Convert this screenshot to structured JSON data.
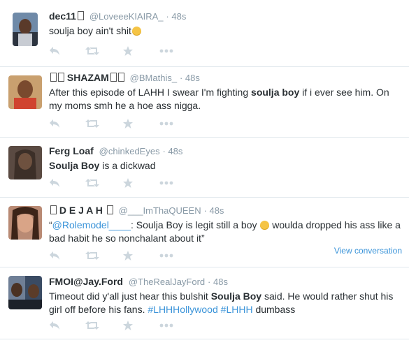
{
  "tweets": [
    {
      "fullname": "dec11",
      "fullname_suffix_box": true,
      "username": "@LoveeeKIAIRA_",
      "time": "48s",
      "text_parts": [
        {
          "t": "soulja boy ain't shit",
          "style": "plain"
        }
      ],
      "emoji_end": "sad-face-emoji"
    },
    {
      "fullname_prefix_boxes": 2,
      "fullname": "SHAZAM",
      "fullname_suffix_boxes": 2,
      "username": "@BMathis_",
      "time": "48s",
      "text_parts": [
        {
          "t": "After this episode of LAHH I swear I'm fighting ",
          "style": "plain"
        },
        {
          "t": "soulja boy",
          "style": "bold"
        },
        {
          "t": " if i ever see him. On my moms smh he a hoe ass nigga.",
          "style": "plain"
        }
      ]
    },
    {
      "fullname": "Ferg Loaf",
      "username": "@chinkedEyes",
      "time": "48s",
      "text_parts": [
        {
          "t": "Soulja Boy",
          "style": "bold"
        },
        {
          "t": " is a dickwad",
          "style": "plain"
        }
      ]
    },
    {
      "fullname_prefix_boxes": 1,
      "fullname": "D E J A H",
      "fullname_suffix_boxes": 1,
      "username": "@___ImThaQUEEN",
      "time": "48s",
      "text_parts": [
        {
          "t": "“",
          "style": "plain"
        },
        {
          "t": "@Rolemodel____",
          "style": "link"
        },
        {
          "t": ": Soulja Boy is legit still a boy ",
          "style": "plain"
        },
        {
          "t": "",
          "style": "emoji"
        },
        {
          "t": " woulda dropped his ass like a bad habit he so nonchalant about it”",
          "style": "plain"
        }
      ],
      "view_conversation": "View conversation"
    },
    {
      "fullname": "FMOI@Jay.Ford",
      "username": "@TheRealJayFord",
      "time": "48s",
      "text_parts": [
        {
          "t": "Timeout did y'all just hear this bulshit ",
          "style": "plain"
        },
        {
          "t": "Soulja Boy",
          "style": "bold"
        },
        {
          "t": " said.  He would rather shut his girl off before his fans.  ",
          "style": "plain"
        },
        {
          "t": "#LHHHollywood",
          "style": "link"
        },
        {
          "t": " ",
          "style": "plain"
        },
        {
          "t": "#LHHH",
          "style": "link"
        },
        {
          "t": " dumbass",
          "style": "plain"
        }
      ]
    }
  ],
  "actions": [
    "reply-icon",
    "retweet-icon",
    "favorite-icon",
    "more-icon"
  ],
  "colors": {
    "link": "#3b94d9",
    "muted": "#8899a6",
    "icon": "#ccd6dd",
    "border": "#e1e8ed"
  }
}
